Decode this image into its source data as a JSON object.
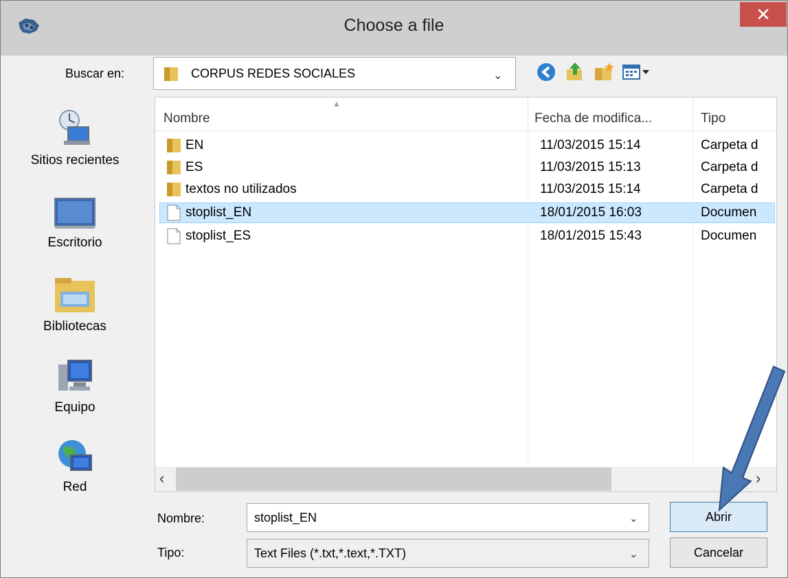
{
  "window": {
    "title": "Choose a file",
    "close_glyph": "✕"
  },
  "toolbar": {
    "lookin_label": "Buscar en:",
    "lookin_value": "CORPUS REDES SOCIALES",
    "buttons": [
      "back-icon",
      "up-folder-icon",
      "new-folder-icon",
      "view-menu-icon"
    ]
  },
  "places": [
    {
      "label": "Sitios recientes",
      "icon": "recent-places-icon"
    },
    {
      "label": "Escritorio",
      "icon": "desktop-icon"
    },
    {
      "label": "Bibliotecas",
      "icon": "libraries-icon"
    },
    {
      "label": "Equipo",
      "icon": "computer-icon"
    },
    {
      "label": "Red",
      "icon": "network-icon"
    }
  ],
  "file_list": {
    "columns": [
      "Nombre",
      "Fecha de modifica...",
      "Tipo"
    ],
    "rows": [
      {
        "name": "EN",
        "date": "11/03/2015 15:14",
        "type": "Carpeta d",
        "icon": "folder-icon"
      },
      {
        "name": "ES",
        "date": "11/03/2015 15:13",
        "type": "Carpeta d",
        "icon": "folder-icon"
      },
      {
        "name": "textos no utilizados",
        "date": "11/03/2015 15:14",
        "type": "Carpeta d",
        "icon": "folder-icon"
      },
      {
        "name": "stoplist_EN",
        "date": "18/01/2015 16:03",
        "type": "Documen",
        "icon": "text-file-icon",
        "selected": true
      },
      {
        "name": "stoplist_ES",
        "date": "18/01/2015 15:43",
        "type": "Documen",
        "icon": "text-file-icon"
      }
    ]
  },
  "form": {
    "name_label": "Nombre:",
    "name_value": "stoplist_EN",
    "type_label": "Tipo:",
    "type_value": "Text Files (*.txt,*.text,*.TXT)",
    "open_button": "Abrir",
    "cancel_button": "Cancelar"
  },
  "colors": {
    "selection": "#cce8ff",
    "close_button": "#c7504a",
    "annotation_arrow": "#4a78b5"
  }
}
